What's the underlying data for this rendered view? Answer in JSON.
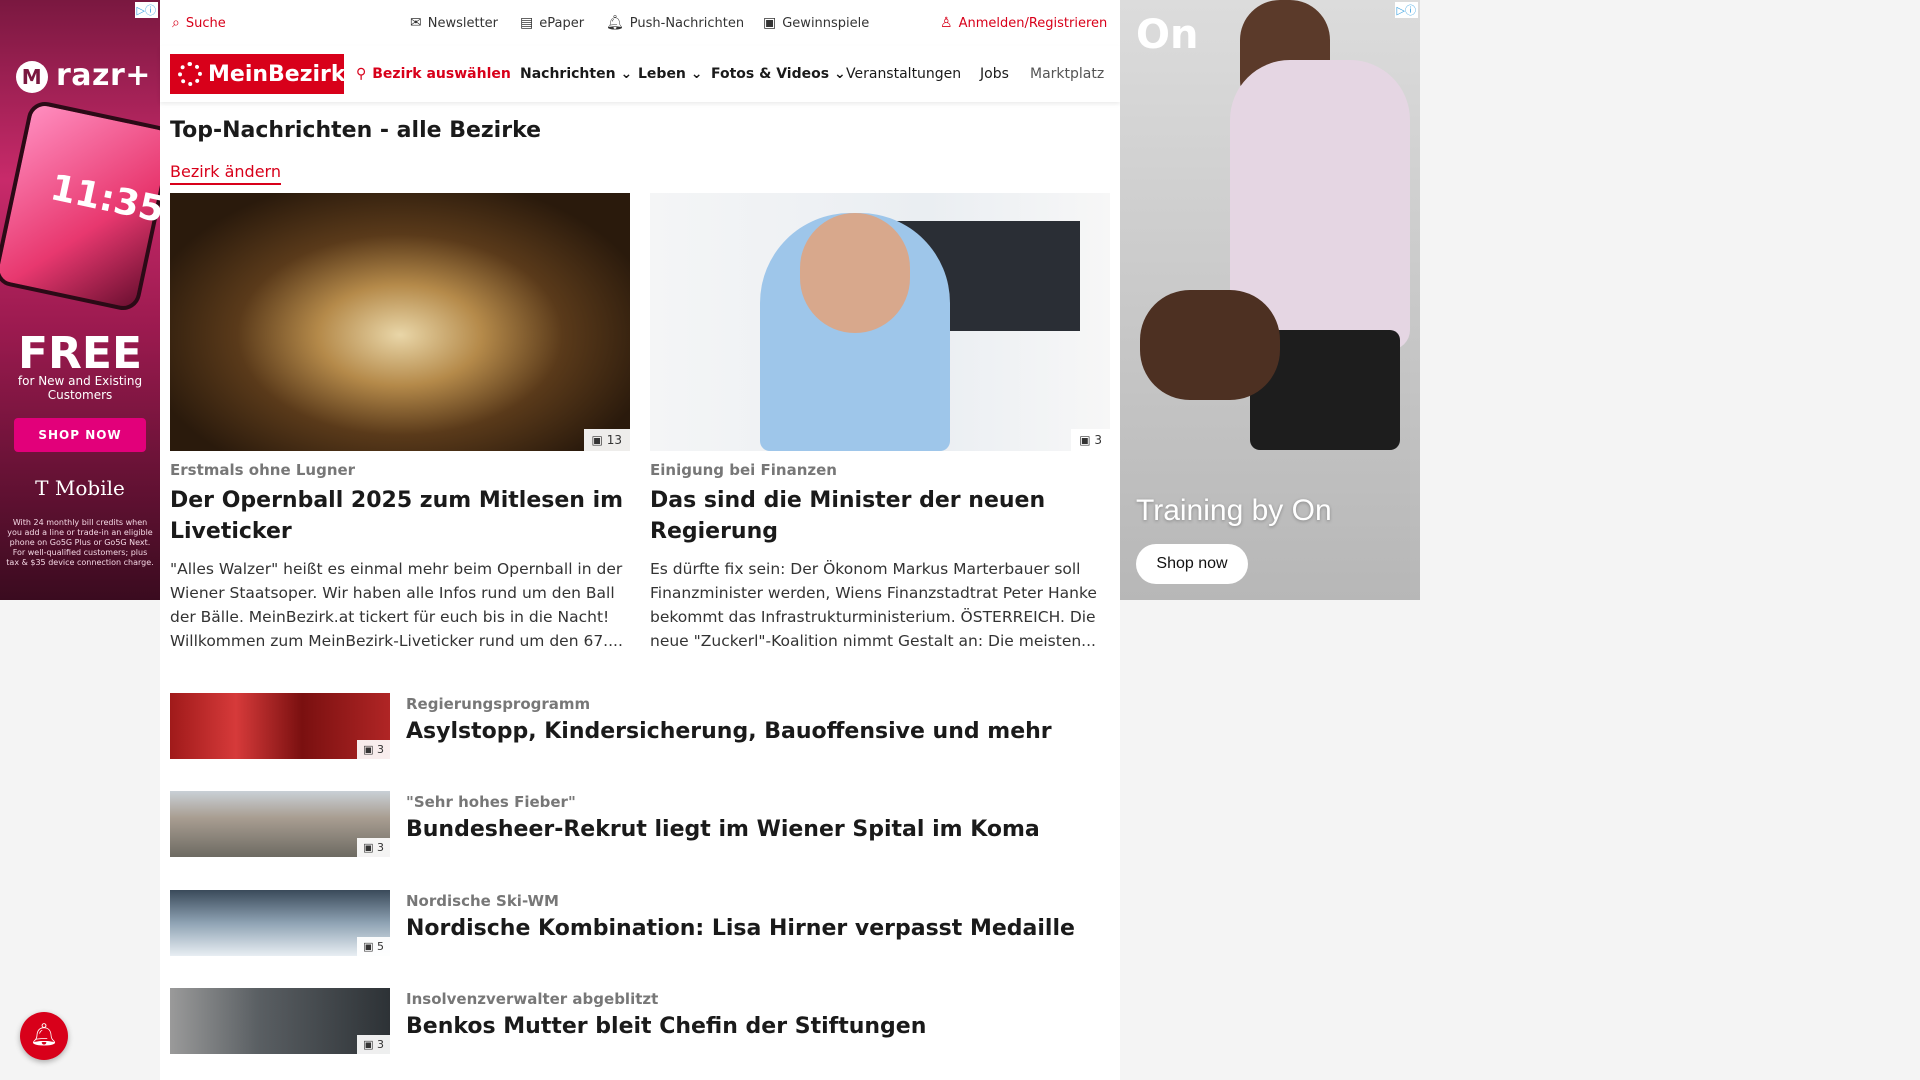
{
  "ads": {
    "left": {
      "brand": "razr+",
      "phone_time": "11:35",
      "headline": "FREE",
      "sub": "for New and Existing Customers",
      "cta": "SHOP NOW",
      "advertiser": "T Mobile",
      "fine_print": "With 24 monthly bill credits when you add a line or trade-in an eligible phone on Go5G Plus or Go5G Next. For well-qualified customers; plus tax & $35 device connection charge."
    },
    "right": {
      "logo": "On",
      "headline": "Training by On",
      "cta": "Shop now"
    }
  },
  "topbar": {
    "search": "Suche",
    "newsletter": "Newsletter",
    "epaper": "ePaper",
    "push": "Push-Nachrichten",
    "gewinnspiele": "Gewinnspiele",
    "login": "Anmelden/Registrieren"
  },
  "nav": {
    "logo": "MeinBezirk",
    "bezirk": "Bezirk auswählen",
    "items": [
      "Nachrichten",
      "Leben",
      "Fotos & Videos",
      "Veranstaltungen",
      "Jobs",
      "Marktplatz"
    ]
  },
  "page": {
    "title": "Top-Nachrichten - alle Bezirke",
    "change_link": "Bezirk ändern"
  },
  "featured": [
    {
      "kicker": "Erstmals ohne Lugner",
      "headline": "Der Opernball 2025 zum Mitlesen im Liveticker",
      "teaser": "\"Alles Walzer\" heißt es einmal mehr beim Opernball in der Wiener Staatsoper. Wir haben alle Infos rund um den Ball der Bälle. MeinBezirk.at tickert für euch bis in die Nacht! Willkommen zum MeinBezirk-Liveticker rund um den 67....",
      "photos": "13"
    },
    {
      "kicker": "Einigung bei Finanzen",
      "headline": "Das sind die Minister der neuen Regierung",
      "teaser": "Es dürfte fix sein: Der Ökonom Markus Marterbauer soll Finanzminister werden, Wiens Finanzstadtrat Peter Hanke bekommt das Infrastrukturministerium. ÖSTERREICH. Die neue \"Zuckerl\"-Koalition nimmt Gestalt an: Die meisten...",
      "photos": "3"
    }
  ],
  "list": [
    {
      "kicker": "Regierungsprogramm",
      "headline": "Asylstopp, Kindersicherung, Bauoffensive und mehr",
      "photos": "3"
    },
    {
      "kicker": "\"Sehr hohes Fieber\"",
      "headline": "Bundesheer-Rekrut liegt im Wiener Spital im Koma",
      "photos": "3"
    },
    {
      "kicker": "Nordische Ski-WM",
      "headline": "Nordische Kombination: Lisa Hirner verpasst Medaille",
      "photos": "5"
    },
    {
      "kicker": "Insolvenzverwalter abgeblitzt",
      "headline": "Benkos Mutter bleit Chefin der Stiftungen",
      "photos": "3"
    }
  ]
}
